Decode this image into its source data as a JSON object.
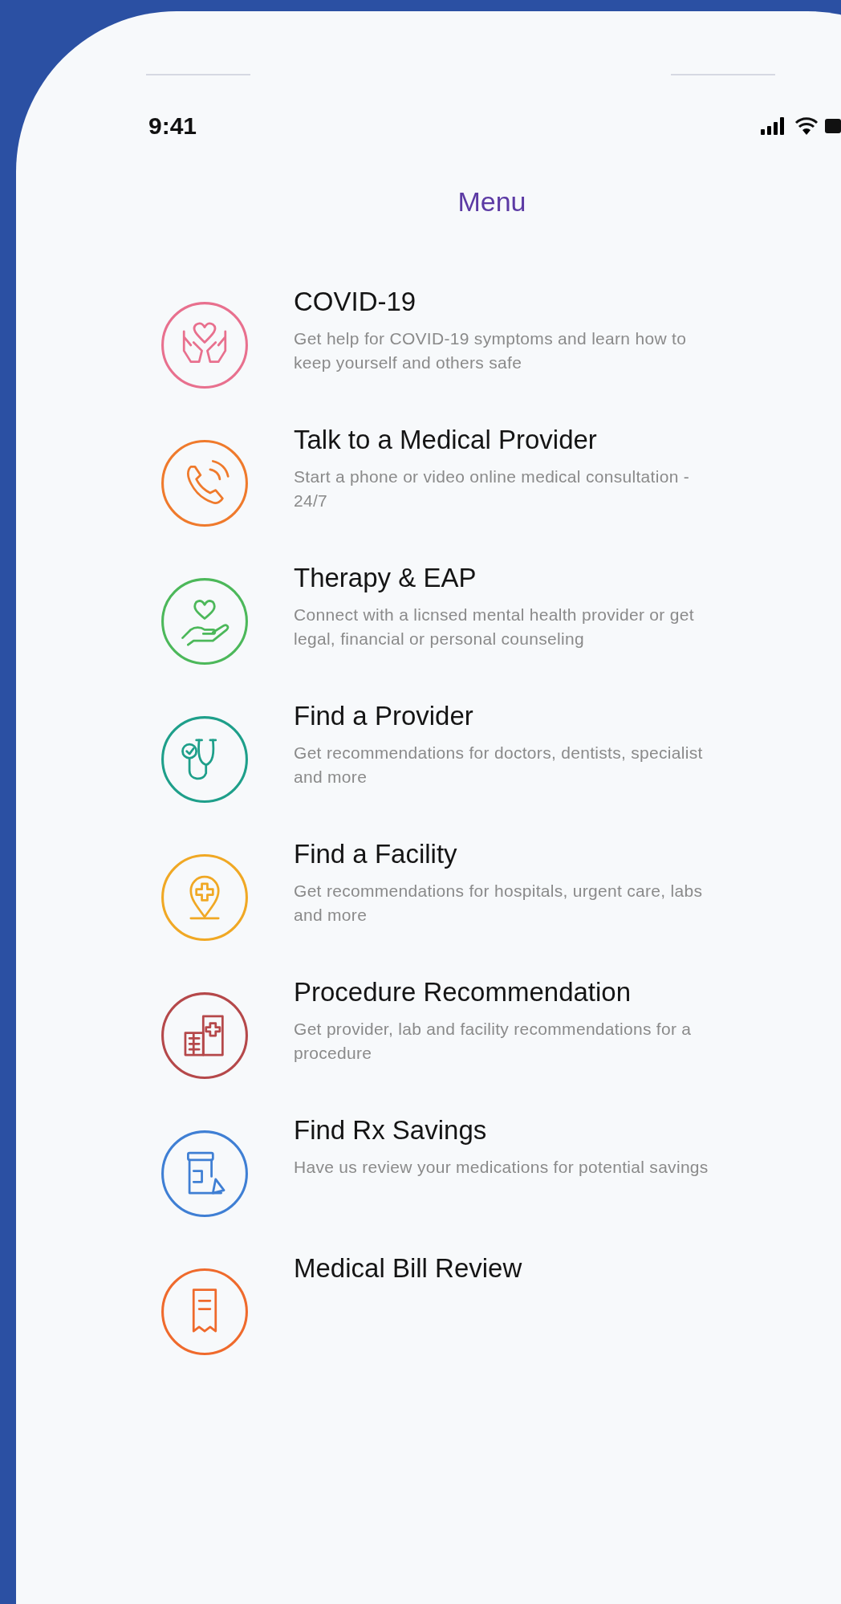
{
  "status_bar": {
    "time": "9:41"
  },
  "header": {
    "title": "Menu"
  },
  "menu_items": [
    {
      "kind": "hands-heart",
      "color": "#e8708e",
      "title": "COVID-19",
      "description": "Get help for COVID-19 symptoms and learn how to keep yourself and others safe"
    },
    {
      "kind": "phone",
      "color": "#ef7a2c",
      "title": "Talk to a Medical Provider",
      "description": "Start a phone or video online medical consultation - 24/7"
    },
    {
      "kind": "hand-heart",
      "color": "#4cb85a",
      "title": "Therapy & EAP",
      "description": "Connect with a licnsed mental health provider or get legal, financial or personal counseling"
    },
    {
      "kind": "stethoscope",
      "color": "#1e9f8a",
      "title": "Find a Provider",
      "description": "Get recommendations for doctors, dentists, specialist and more"
    },
    {
      "kind": "pin",
      "color": "#f0a824",
      "title": "Find a Facility",
      "description": "Get recommendations for hospitals, urgent care, labs and more"
    },
    {
      "kind": "buildings",
      "color": "#b5484a",
      "title": "Procedure Recommendation",
      "description": "Get provider, lab and facility recommendations for a procedure"
    },
    {
      "kind": "pill-bottle",
      "color": "#3f7fd4",
      "title": "Find Rx Savings",
      "description": "Have us review your medications for potential savings"
    },
    {
      "kind": "bill",
      "color": "#ef6a2c",
      "title": "Medical Bill Review"
    }
  ]
}
